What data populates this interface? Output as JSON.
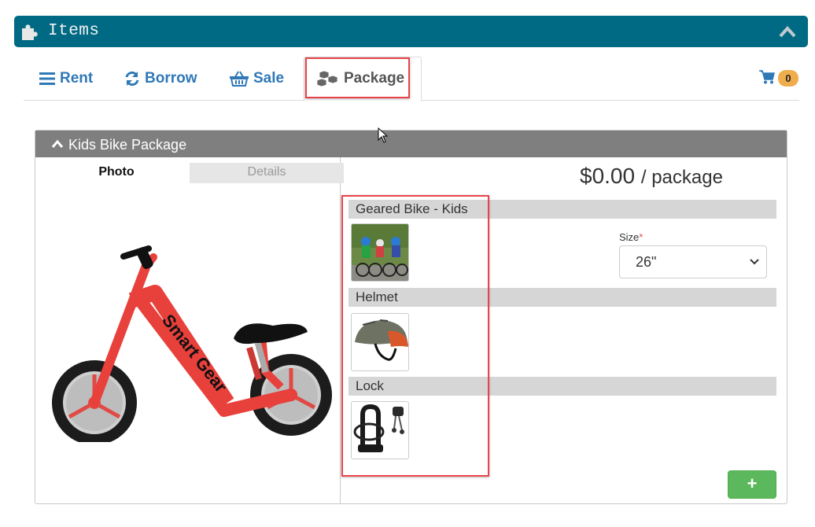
{
  "header": {
    "title": "Items"
  },
  "tabs": [
    {
      "label": "Rent",
      "icon": "list-icon"
    },
    {
      "label": "Borrow",
      "icon": "refresh-icon"
    },
    {
      "label": "Sale",
      "icon": "basket-icon"
    },
    {
      "label": "Package",
      "icon": "cubes-icon",
      "active": true
    }
  ],
  "cart": {
    "count": "0"
  },
  "package": {
    "title": "Kids Bike Package",
    "photo_tab": "Photo",
    "details_tab": "Details",
    "price": "$0.00",
    "price_unit": "/ package",
    "items": [
      {
        "name": "Geared Bike - Kids"
      },
      {
        "name": "Helmet"
      },
      {
        "name": "Lock"
      }
    ],
    "size": {
      "label": "Size",
      "required_mark": "*",
      "value": "26\""
    },
    "bike_brand": "Smart Gear",
    "add_button": "+"
  },
  "colors": {
    "header": "#006983",
    "link": "#2f78b7",
    "highlight": "#e8434a",
    "add": "#5cb85c",
    "badge": "#f0ad4e"
  }
}
